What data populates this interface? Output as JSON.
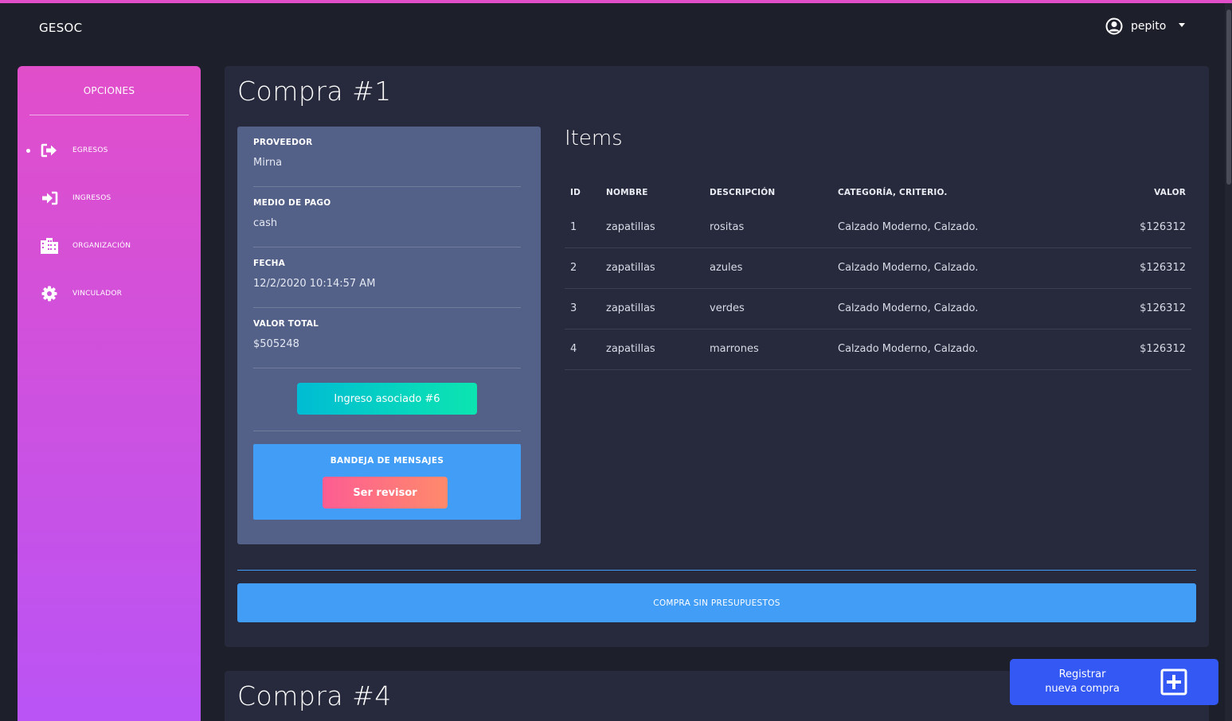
{
  "app": {
    "brand": "GESOC"
  },
  "user": {
    "name": "pepito"
  },
  "sidebar": {
    "title": "OPCIONES",
    "items": [
      {
        "label": "EGRESOS",
        "icon": "sign-out-icon",
        "active": true
      },
      {
        "label": "INGRESOS",
        "icon": "sign-in-icon",
        "active": false
      },
      {
        "label": "ORGANIZACIÓN",
        "icon": "building-icon",
        "active": false
      },
      {
        "label": "VINCULADOR",
        "icon": "gear-icon",
        "active": false
      }
    ]
  },
  "compra1": {
    "title": "Compra #1",
    "proveedor_label": "PROVEEDOR",
    "proveedor": "Mirna",
    "medio_label": "MEDIO DE PAGO",
    "medio": "cash",
    "fecha_label": "FECHA",
    "fecha": "12/2/2020 10:14:57 AM",
    "valor_label": "VALOR TOTAL",
    "valor": "$505248",
    "ingreso_button": "Ingreso asociado #6",
    "bandeja_title": "BANDEJA DE MENSAJES",
    "revisor_button": "Ser revisor",
    "items_title": "Items",
    "columns": [
      "ID",
      "NOMBRE",
      "DESCRIPCIÓN",
      "CATEGORÍA, CRITERIO.",
      "VALOR"
    ],
    "rows": [
      [
        "1",
        "zapatillas",
        "rositas",
        "Calzado Moderno, Calzado.",
        "$126312"
      ],
      [
        "2",
        "zapatillas",
        "azules",
        "Calzado Moderno, Calzado.",
        "$126312"
      ],
      [
        "3",
        "zapatillas",
        "verdes",
        "Calzado Moderno, Calzado.",
        "$126312"
      ],
      [
        "4",
        "zapatillas",
        "marrones",
        "Calzado Moderno, Calzado.",
        "$126312"
      ]
    ],
    "sin_presupuestos_button": "COMPRA SIN PRESUPUESTOS"
  },
  "compra2": {
    "title": "Compra #4"
  },
  "fab": {
    "line1": "Registrar",
    "line2": "nueva compra",
    "icon": "plus-square-icon"
  },
  "colors": {
    "accent_pink": "#e14eca",
    "accent_purple": "#ba54f5",
    "card_bg": "#27293d",
    "panel_bg": "#536088",
    "info_blue": "#429df7",
    "primary_blue": "#3358f4"
  }
}
